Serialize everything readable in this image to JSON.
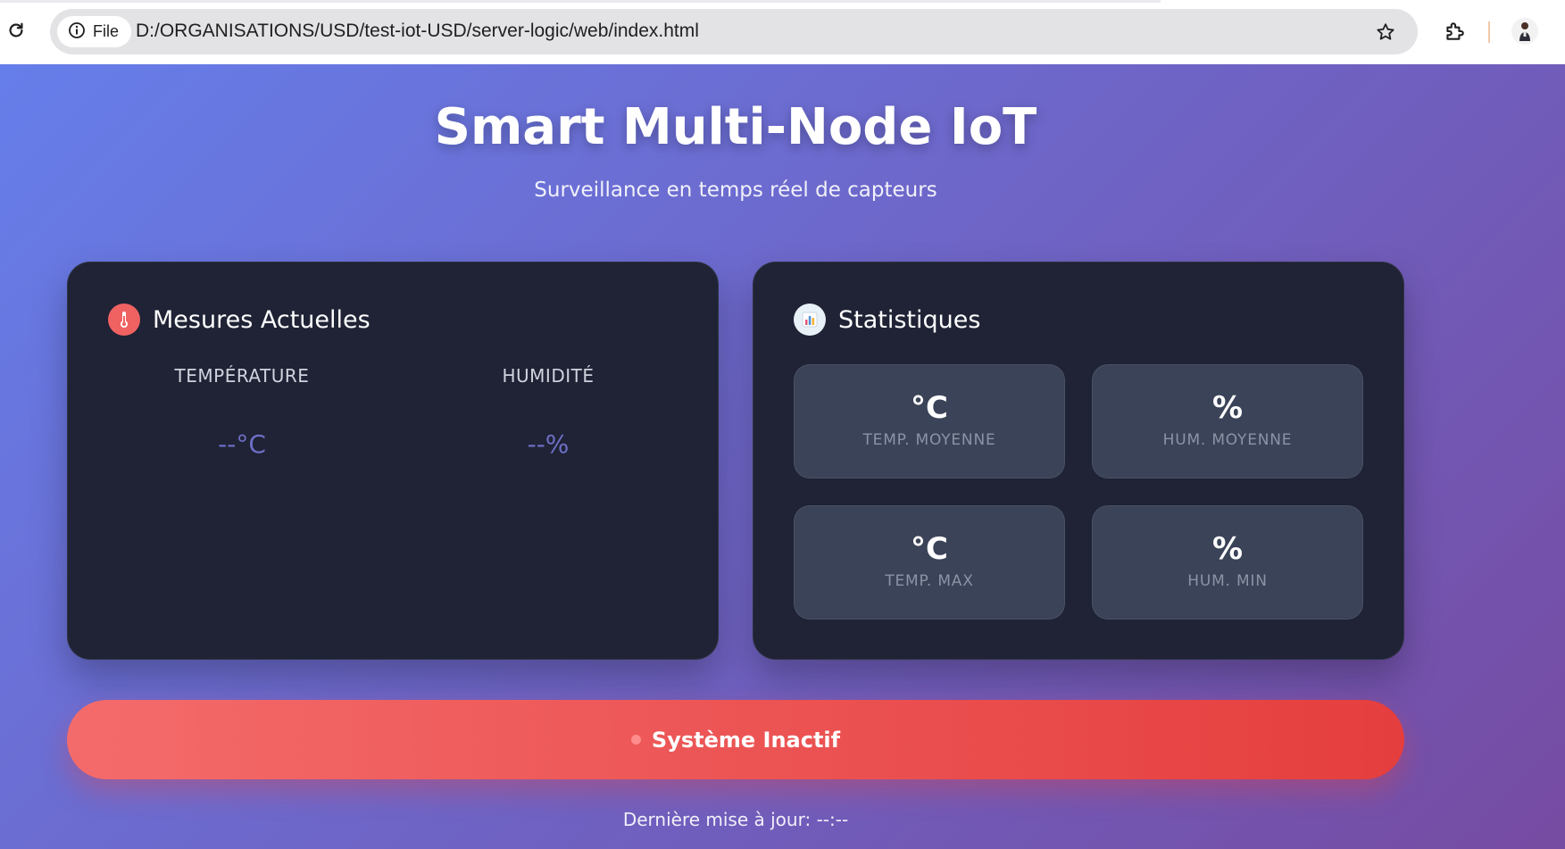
{
  "browser": {
    "site_chip_label": "File",
    "url": "D:/ORGANISATIONS/USD/test-iot-USD/server-logic/web/index.html"
  },
  "header": {
    "title": "Smart Multi-Node IoT",
    "subtitle": "Surveillance en temps réel de capteurs"
  },
  "current": {
    "title": "Mesures Actuelles",
    "icon": "thermometer-icon",
    "temperature_label": "TEMPÉRATURE",
    "temperature_value": "--°C",
    "humidity_label": "HUMIDITÉ",
    "humidity_value": "--%",
    "value_color": "#6e6fc7"
  },
  "stats": {
    "title": "Statistiques",
    "icon": "bar-chart-icon",
    "items": [
      {
        "value": "°C",
        "label": "TEMP. MOYENNE"
      },
      {
        "value": "%",
        "label": "HUM. MOYENNE"
      },
      {
        "value": "°C",
        "label": "TEMP. MAX"
      },
      {
        "value": "%",
        "label": "HUM. MIN"
      }
    ]
  },
  "status": {
    "text": "Système Inactif",
    "color": "#e53e3e"
  },
  "footer": {
    "last_update_label": "Dernière mise à jour:",
    "last_update_value": "--:--"
  },
  "colors": {
    "gradient_start": "#667eea",
    "gradient_end": "#764ba2",
    "card_bg": "#1f2335",
    "stat_bg": "#3a4357"
  }
}
